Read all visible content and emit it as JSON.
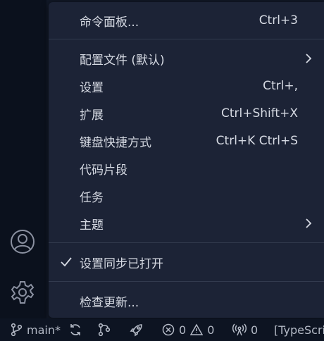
{
  "menu": {
    "items": [
      {
        "label": "命令面板...",
        "shortcut": "Ctrl+3"
      },
      {
        "label": "配置文件 (默认)",
        "submenu": true
      },
      {
        "label": "设置",
        "shortcut": "Ctrl+,"
      },
      {
        "label": "扩展",
        "shortcut": "Ctrl+Shift+X"
      },
      {
        "label": "键盘快捷方式",
        "shortcut": "Ctrl+K Ctrl+S"
      },
      {
        "label": "代码片段"
      },
      {
        "label": "任务"
      },
      {
        "label": "主题",
        "submenu": true
      },
      {
        "label": "设置同步已打开",
        "checked": true
      },
      {
        "label": "检查更新..."
      }
    ]
  },
  "activity_bar": {
    "icons": [
      "account-icon",
      "gear-icon"
    ]
  },
  "status_bar": {
    "branch": "main*",
    "errors": "0",
    "warnings": "0",
    "ports": "0",
    "language": "[TypeScri"
  },
  "colors": {
    "menu_bg": "#1c2336",
    "menu_text": "#d6dae3",
    "separator": "#323a4e",
    "activity_bar_bg": "#0b111d",
    "status_bar_bg": "#0d1422"
  }
}
